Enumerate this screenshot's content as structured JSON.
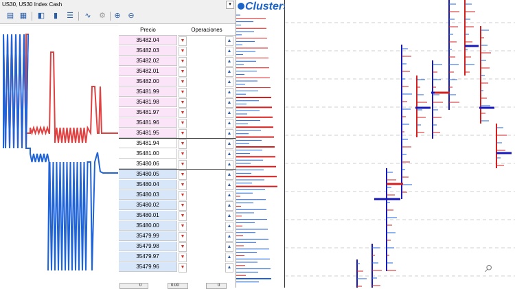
{
  "window": {
    "title": "US30, US30 Index Cash"
  },
  "toolbar": {
    "icons": [
      "chart-icon",
      "calculator-icon",
      "one-click-icon",
      "volume-icon",
      "depth-icon",
      "tick-chart-icon",
      "gear-icon",
      "zoom-in-icon",
      "zoom-out-icon"
    ]
  },
  "dom": {
    "price_header": "Precio",
    "operations_header": "Operaciones",
    "ask_rows": [
      "35482.04",
      "35482.03",
      "35482.02",
      "35482.01",
      "35482.00",
      "35481.99",
      "35481.98",
      "35481.97",
      "35481.96",
      "35481.95"
    ],
    "mid_rows": [
      "35481.94",
      "35481.00",
      "35480.06"
    ],
    "bid_rows": [
      "35480.05",
      "35480.04",
      "35480.03",
      "35480.02",
      "35480.01",
      "35480.00",
      "35479.99",
      "35479.98",
      "35479.97",
      "35479.96"
    ]
  },
  "bottom_controls": [
    "0",
    "0.00",
    "0"
  ],
  "clusters": {
    "logo_text": "Clusters"
  },
  "colors": {
    "ask_bg": "#fbe3f8",
    "bid_bg": "#d7e6f8",
    "sell_red": "#e04040",
    "buy_blue": "#1f63d8",
    "footprint_red": "#d41f1f",
    "footprint_blue": "#1818b8"
  }
}
